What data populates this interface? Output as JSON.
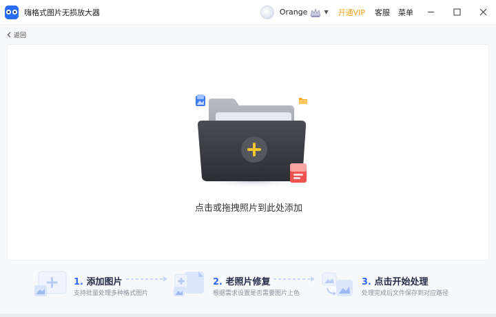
{
  "app": {
    "title": "嗨格式图片无损放大器"
  },
  "header": {
    "user_name": "Orange",
    "open_vip": "开通VIP",
    "service": "客服",
    "menu": "菜单"
  },
  "nav": {
    "back_label": "返回"
  },
  "dropzone": {
    "text": "点击或拖拽照片到此处添加"
  },
  "steps": [
    {
      "title_num": "1.",
      "title": "添加图片",
      "desc": "支持批量处理多种格式图片"
    },
    {
      "title_num": "2.",
      "title": "老照片修复",
      "desc": "根据需求设置是否需要图片上色"
    },
    {
      "title_num": "3.",
      "title": "点击开始处理",
      "desc": "处理完成后文件保存到对应路径"
    }
  ],
  "colors": {
    "accent": "#2f6cf3",
    "vip": "#f0a21b",
    "folder": "#3a3c42",
    "plus": "#f5c528"
  }
}
